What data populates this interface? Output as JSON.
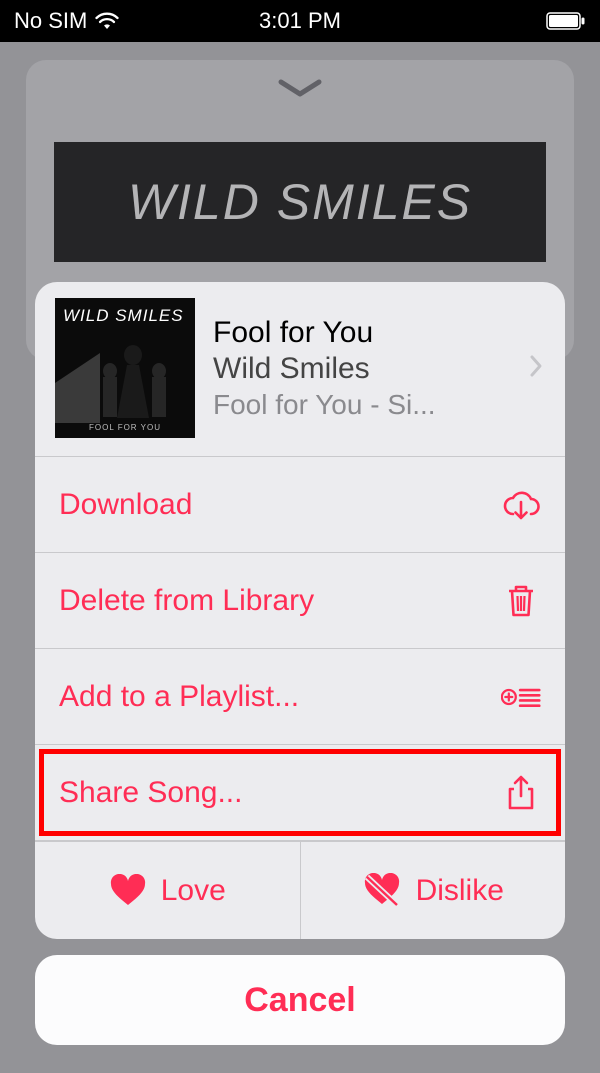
{
  "status_bar": {
    "carrier": "No SIM",
    "time": "3:01 PM"
  },
  "background": {
    "banner_text": "WILD SMILES"
  },
  "album_art": {
    "title_text": "WILD SMILES",
    "sub_text": "FOOL FOR YOU"
  },
  "song": {
    "title": "Fool for You",
    "artist": "Wild Smiles",
    "album": "Fool for You - Si..."
  },
  "actions": {
    "download": "Download",
    "delete": "Delete from Library",
    "playlist": "Add to a Playlist...",
    "share": "Share Song..."
  },
  "reactions": {
    "love": "Love",
    "dislike": "Dislike"
  },
  "cancel": "Cancel",
  "highlighted_action": "share",
  "colors": {
    "accent": "#ff2d55",
    "highlight_border": "#ff0000"
  }
}
